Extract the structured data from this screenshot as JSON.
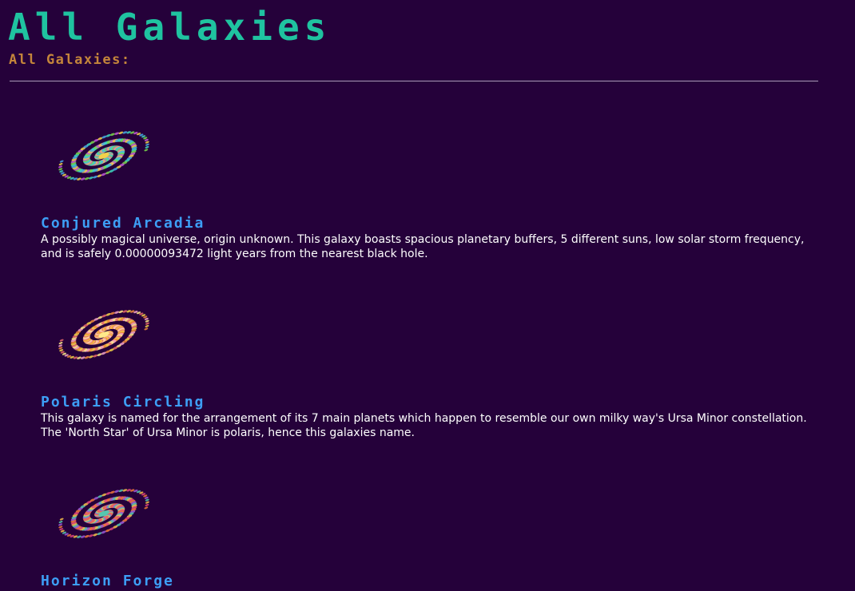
{
  "header": {
    "title": "All Galaxies",
    "subtitle": "All Galaxies:"
  },
  "galaxies": [
    {
      "name": "Conjured Arcadia",
      "description": "A possibly magical universe, origin unknown. This galaxy boasts spacious planetary buffers, 5 different suns, low solar storm frequency, and is safely 0.00000093472 light years from the nearest black hole.",
      "image_icon": "spiral-galaxy-icon",
      "palette": [
        "#3fd8c0",
        "#7ad94a",
        "#c35bd6",
        "#f2d24a",
        "#4aa8e8"
      ]
    },
    {
      "name": "Polaris Circling",
      "description": "This galaxy is named for the arrangement of its 7 main planets which happen to resemble our own milky way's Ursa Minor constellation. The 'North Star' of Ursa Minor is polaris, hence this galaxies name.",
      "image_icon": "spiral-galaxy-icon",
      "palette": [
        "#f5d548",
        "#f08a3c",
        "#f5a3c8",
        "#ffe98a",
        "#e86a6a"
      ]
    },
    {
      "name": "Horizon Forge",
      "description": "",
      "image_icon": "spiral-galaxy-icon",
      "palette": [
        "#e0457f",
        "#f07a3a",
        "#9b5ad8",
        "#55c7b0",
        "#f5c04a"
      ]
    }
  ]
}
